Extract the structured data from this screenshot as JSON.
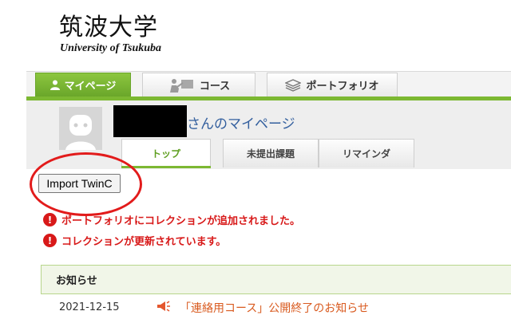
{
  "header": {
    "logo_jp": "筑波大学",
    "logo_en": "University of Tsukuba"
  },
  "nav": {
    "tabs": [
      {
        "label": "マイページ",
        "active": true
      },
      {
        "label": "コース",
        "active": false
      },
      {
        "label": "ポートフォリオ",
        "active": false
      }
    ]
  },
  "profile": {
    "title": "さんのマイページ",
    "sub_tabs": [
      {
        "label": "トップ",
        "active": true
      },
      {
        "label": "未提出課題",
        "active": false
      },
      {
        "label": "リマインダ",
        "active": false
      }
    ]
  },
  "import_button": {
    "label": "Import TwinC"
  },
  "alerts": [
    {
      "icon": "!",
      "text": "ポートフォリオにコレクションが追加されました。"
    },
    {
      "icon": "!",
      "text": "コレクションが更新されています。"
    }
  ],
  "notices": {
    "heading": "お知らせ",
    "items": [
      {
        "date": "2021-12-15",
        "text": "「連絡用コース」公開終了のお知らせ"
      }
    ]
  },
  "colors": {
    "accent_green": "#7cb832",
    "alert_red": "#d81919",
    "link_orange": "#d95b20",
    "title_blue": "#335f9e"
  }
}
